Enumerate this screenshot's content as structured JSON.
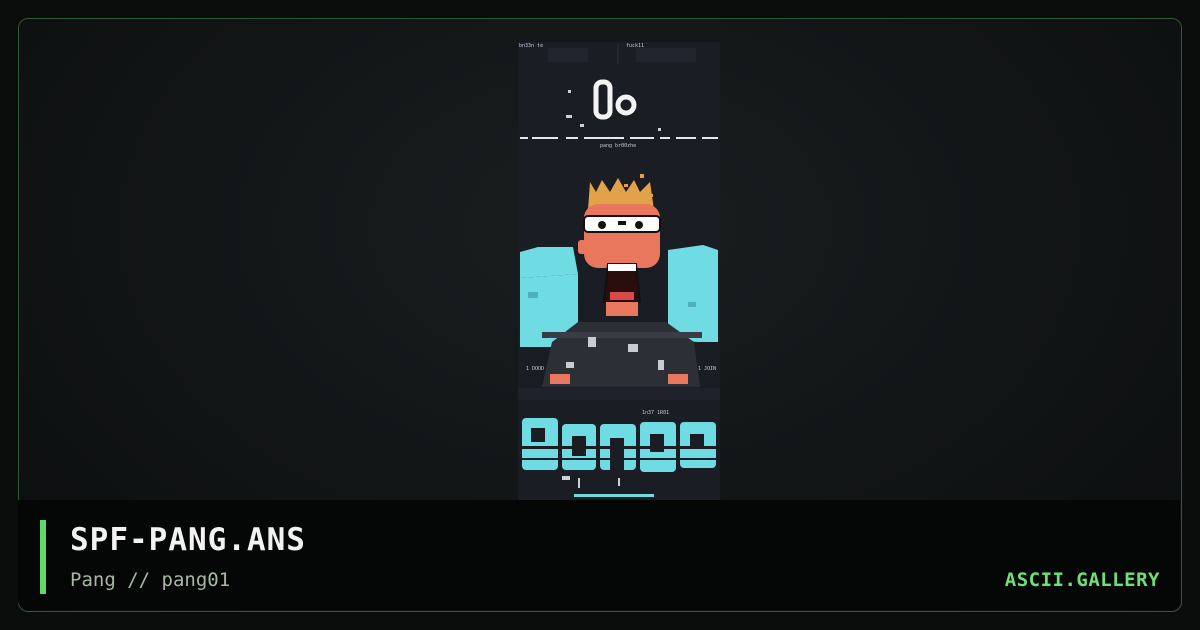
{
  "artwork": {
    "header_left": "bn33n te",
    "header_right": "fuck11",
    "credit_line": "pang  br00zhe",
    "side_tag_left": "1 DOOD",
    "side_tag_right": "1 JOIN",
    "small_tag": "1n37  1R01",
    "logo_text": "PANG",
    "badge_text": "0o",
    "colors": {
      "background": "#1b1d25",
      "cyan": "#6fdbe3",
      "skin": "#e8775e",
      "hair": "#e2a24a",
      "shirt": "#2c2f36"
    }
  },
  "info": {
    "filename": "SPF-PANG.ANS",
    "subtitle": "Pang // pang01",
    "site": "ASCII.GALLERY"
  },
  "colors": {
    "accent": "#5fd86a",
    "border": "#2f5a34",
    "page_background": "#0a0d0c"
  }
}
